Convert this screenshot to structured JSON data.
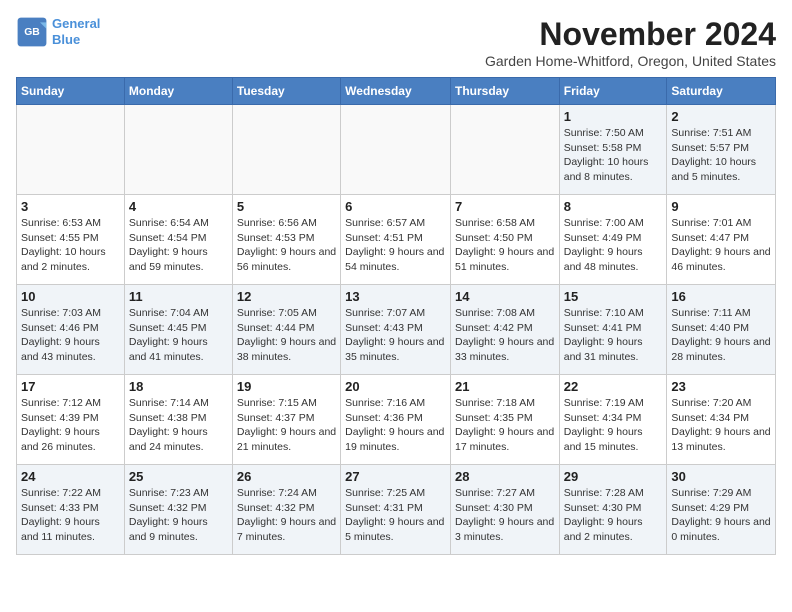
{
  "header": {
    "logo_line1": "General",
    "logo_line2": "Blue",
    "month": "November 2024",
    "location": "Garden Home-Whitford, Oregon, United States"
  },
  "weekdays": [
    "Sunday",
    "Monday",
    "Tuesday",
    "Wednesday",
    "Thursday",
    "Friday",
    "Saturday"
  ],
  "weeks": [
    [
      {
        "day": "",
        "info": ""
      },
      {
        "day": "",
        "info": ""
      },
      {
        "day": "",
        "info": ""
      },
      {
        "day": "",
        "info": ""
      },
      {
        "day": "",
        "info": ""
      },
      {
        "day": "1",
        "info": "Sunrise: 7:50 AM\nSunset: 5:58 PM\nDaylight: 10 hours and 8 minutes."
      },
      {
        "day": "2",
        "info": "Sunrise: 7:51 AM\nSunset: 5:57 PM\nDaylight: 10 hours and 5 minutes."
      }
    ],
    [
      {
        "day": "3",
        "info": "Sunrise: 6:53 AM\nSunset: 4:55 PM\nDaylight: 10 hours and 2 minutes."
      },
      {
        "day": "4",
        "info": "Sunrise: 6:54 AM\nSunset: 4:54 PM\nDaylight: 9 hours and 59 minutes."
      },
      {
        "day": "5",
        "info": "Sunrise: 6:56 AM\nSunset: 4:53 PM\nDaylight: 9 hours and 56 minutes."
      },
      {
        "day": "6",
        "info": "Sunrise: 6:57 AM\nSunset: 4:51 PM\nDaylight: 9 hours and 54 minutes."
      },
      {
        "day": "7",
        "info": "Sunrise: 6:58 AM\nSunset: 4:50 PM\nDaylight: 9 hours and 51 minutes."
      },
      {
        "day": "8",
        "info": "Sunrise: 7:00 AM\nSunset: 4:49 PM\nDaylight: 9 hours and 48 minutes."
      },
      {
        "day": "9",
        "info": "Sunrise: 7:01 AM\nSunset: 4:47 PM\nDaylight: 9 hours and 46 minutes."
      }
    ],
    [
      {
        "day": "10",
        "info": "Sunrise: 7:03 AM\nSunset: 4:46 PM\nDaylight: 9 hours and 43 minutes."
      },
      {
        "day": "11",
        "info": "Sunrise: 7:04 AM\nSunset: 4:45 PM\nDaylight: 9 hours and 41 minutes."
      },
      {
        "day": "12",
        "info": "Sunrise: 7:05 AM\nSunset: 4:44 PM\nDaylight: 9 hours and 38 minutes."
      },
      {
        "day": "13",
        "info": "Sunrise: 7:07 AM\nSunset: 4:43 PM\nDaylight: 9 hours and 35 minutes."
      },
      {
        "day": "14",
        "info": "Sunrise: 7:08 AM\nSunset: 4:42 PM\nDaylight: 9 hours and 33 minutes."
      },
      {
        "day": "15",
        "info": "Sunrise: 7:10 AM\nSunset: 4:41 PM\nDaylight: 9 hours and 31 minutes."
      },
      {
        "day": "16",
        "info": "Sunrise: 7:11 AM\nSunset: 4:40 PM\nDaylight: 9 hours and 28 minutes."
      }
    ],
    [
      {
        "day": "17",
        "info": "Sunrise: 7:12 AM\nSunset: 4:39 PM\nDaylight: 9 hours and 26 minutes."
      },
      {
        "day": "18",
        "info": "Sunrise: 7:14 AM\nSunset: 4:38 PM\nDaylight: 9 hours and 24 minutes."
      },
      {
        "day": "19",
        "info": "Sunrise: 7:15 AM\nSunset: 4:37 PM\nDaylight: 9 hours and 21 minutes."
      },
      {
        "day": "20",
        "info": "Sunrise: 7:16 AM\nSunset: 4:36 PM\nDaylight: 9 hours and 19 minutes."
      },
      {
        "day": "21",
        "info": "Sunrise: 7:18 AM\nSunset: 4:35 PM\nDaylight: 9 hours and 17 minutes."
      },
      {
        "day": "22",
        "info": "Sunrise: 7:19 AM\nSunset: 4:34 PM\nDaylight: 9 hours and 15 minutes."
      },
      {
        "day": "23",
        "info": "Sunrise: 7:20 AM\nSunset: 4:34 PM\nDaylight: 9 hours and 13 minutes."
      }
    ],
    [
      {
        "day": "24",
        "info": "Sunrise: 7:22 AM\nSunset: 4:33 PM\nDaylight: 9 hours and 11 minutes."
      },
      {
        "day": "25",
        "info": "Sunrise: 7:23 AM\nSunset: 4:32 PM\nDaylight: 9 hours and 9 minutes."
      },
      {
        "day": "26",
        "info": "Sunrise: 7:24 AM\nSunset: 4:32 PM\nDaylight: 9 hours and 7 minutes."
      },
      {
        "day": "27",
        "info": "Sunrise: 7:25 AM\nSunset: 4:31 PM\nDaylight: 9 hours and 5 minutes."
      },
      {
        "day": "28",
        "info": "Sunrise: 7:27 AM\nSunset: 4:30 PM\nDaylight: 9 hours and 3 minutes."
      },
      {
        "day": "29",
        "info": "Sunrise: 7:28 AM\nSunset: 4:30 PM\nDaylight: 9 hours and 2 minutes."
      },
      {
        "day": "30",
        "info": "Sunrise: 7:29 AM\nSunset: 4:29 PM\nDaylight: 9 hours and 0 minutes."
      }
    ]
  ]
}
